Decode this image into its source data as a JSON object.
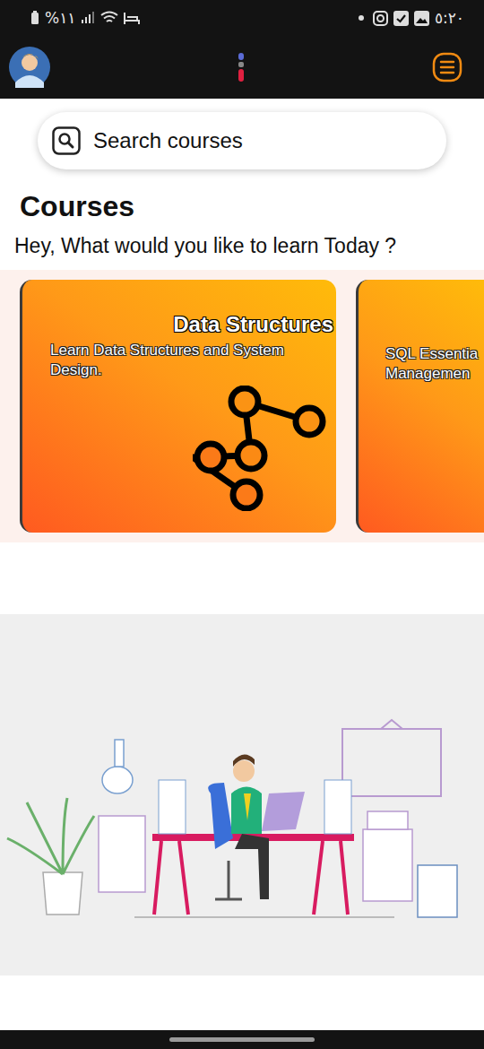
{
  "status_bar": {
    "battery": "%۱۱",
    "time": "٥:٢٠"
  },
  "search": {
    "placeholder": "Search courses"
  },
  "heading": "Courses",
  "subheading": "Hey, What would you like to learn Today ?",
  "courses": [
    {
      "title": "Data Structures",
      "lines": [
        "Learn Data Structures and System",
        "Design."
      ],
      "kind": "full"
    },
    {
      "lines": [
        "SQL Essentia",
        "Managemen"
      ],
      "kind": "clipped"
    }
  ]
}
